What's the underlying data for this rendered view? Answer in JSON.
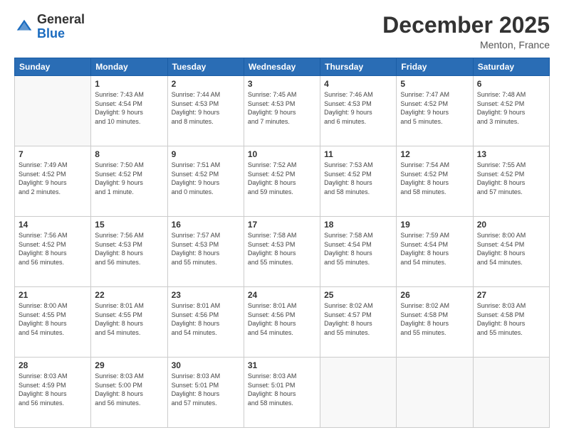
{
  "header": {
    "logo_general": "General",
    "logo_blue": "Blue",
    "month_title": "December 2025",
    "location": "Menton, France"
  },
  "days_of_week": [
    "Sunday",
    "Monday",
    "Tuesday",
    "Wednesday",
    "Thursday",
    "Friday",
    "Saturday"
  ],
  "weeks": [
    [
      {
        "day": "",
        "info": ""
      },
      {
        "day": "1",
        "info": "Sunrise: 7:43 AM\nSunset: 4:54 PM\nDaylight: 9 hours\nand 10 minutes."
      },
      {
        "day": "2",
        "info": "Sunrise: 7:44 AM\nSunset: 4:53 PM\nDaylight: 9 hours\nand 8 minutes."
      },
      {
        "day": "3",
        "info": "Sunrise: 7:45 AM\nSunset: 4:53 PM\nDaylight: 9 hours\nand 7 minutes."
      },
      {
        "day": "4",
        "info": "Sunrise: 7:46 AM\nSunset: 4:53 PM\nDaylight: 9 hours\nand 6 minutes."
      },
      {
        "day": "5",
        "info": "Sunrise: 7:47 AM\nSunset: 4:52 PM\nDaylight: 9 hours\nand 5 minutes."
      },
      {
        "day": "6",
        "info": "Sunrise: 7:48 AM\nSunset: 4:52 PM\nDaylight: 9 hours\nand 3 minutes."
      }
    ],
    [
      {
        "day": "7",
        "info": "Sunrise: 7:49 AM\nSunset: 4:52 PM\nDaylight: 9 hours\nand 2 minutes."
      },
      {
        "day": "8",
        "info": "Sunrise: 7:50 AM\nSunset: 4:52 PM\nDaylight: 9 hours\nand 1 minute."
      },
      {
        "day": "9",
        "info": "Sunrise: 7:51 AM\nSunset: 4:52 PM\nDaylight: 9 hours\nand 0 minutes."
      },
      {
        "day": "10",
        "info": "Sunrise: 7:52 AM\nSunset: 4:52 PM\nDaylight: 8 hours\nand 59 minutes."
      },
      {
        "day": "11",
        "info": "Sunrise: 7:53 AM\nSunset: 4:52 PM\nDaylight: 8 hours\nand 58 minutes."
      },
      {
        "day": "12",
        "info": "Sunrise: 7:54 AM\nSunset: 4:52 PM\nDaylight: 8 hours\nand 58 minutes."
      },
      {
        "day": "13",
        "info": "Sunrise: 7:55 AM\nSunset: 4:52 PM\nDaylight: 8 hours\nand 57 minutes."
      }
    ],
    [
      {
        "day": "14",
        "info": "Sunrise: 7:56 AM\nSunset: 4:52 PM\nDaylight: 8 hours\nand 56 minutes."
      },
      {
        "day": "15",
        "info": "Sunrise: 7:56 AM\nSunset: 4:53 PM\nDaylight: 8 hours\nand 56 minutes."
      },
      {
        "day": "16",
        "info": "Sunrise: 7:57 AM\nSunset: 4:53 PM\nDaylight: 8 hours\nand 55 minutes."
      },
      {
        "day": "17",
        "info": "Sunrise: 7:58 AM\nSunset: 4:53 PM\nDaylight: 8 hours\nand 55 minutes."
      },
      {
        "day": "18",
        "info": "Sunrise: 7:58 AM\nSunset: 4:54 PM\nDaylight: 8 hours\nand 55 minutes."
      },
      {
        "day": "19",
        "info": "Sunrise: 7:59 AM\nSunset: 4:54 PM\nDaylight: 8 hours\nand 54 minutes."
      },
      {
        "day": "20",
        "info": "Sunrise: 8:00 AM\nSunset: 4:54 PM\nDaylight: 8 hours\nand 54 minutes."
      }
    ],
    [
      {
        "day": "21",
        "info": "Sunrise: 8:00 AM\nSunset: 4:55 PM\nDaylight: 8 hours\nand 54 minutes."
      },
      {
        "day": "22",
        "info": "Sunrise: 8:01 AM\nSunset: 4:55 PM\nDaylight: 8 hours\nand 54 minutes."
      },
      {
        "day": "23",
        "info": "Sunrise: 8:01 AM\nSunset: 4:56 PM\nDaylight: 8 hours\nand 54 minutes."
      },
      {
        "day": "24",
        "info": "Sunrise: 8:01 AM\nSunset: 4:56 PM\nDaylight: 8 hours\nand 54 minutes."
      },
      {
        "day": "25",
        "info": "Sunrise: 8:02 AM\nSunset: 4:57 PM\nDaylight: 8 hours\nand 55 minutes."
      },
      {
        "day": "26",
        "info": "Sunrise: 8:02 AM\nSunset: 4:58 PM\nDaylight: 8 hours\nand 55 minutes."
      },
      {
        "day": "27",
        "info": "Sunrise: 8:03 AM\nSunset: 4:58 PM\nDaylight: 8 hours\nand 55 minutes."
      }
    ],
    [
      {
        "day": "28",
        "info": "Sunrise: 8:03 AM\nSunset: 4:59 PM\nDaylight: 8 hours\nand 56 minutes."
      },
      {
        "day": "29",
        "info": "Sunrise: 8:03 AM\nSunset: 5:00 PM\nDaylight: 8 hours\nand 56 minutes."
      },
      {
        "day": "30",
        "info": "Sunrise: 8:03 AM\nSunset: 5:01 PM\nDaylight: 8 hours\nand 57 minutes."
      },
      {
        "day": "31",
        "info": "Sunrise: 8:03 AM\nSunset: 5:01 PM\nDaylight: 8 hours\nand 58 minutes."
      },
      {
        "day": "",
        "info": ""
      },
      {
        "day": "",
        "info": ""
      },
      {
        "day": "",
        "info": ""
      }
    ]
  ]
}
